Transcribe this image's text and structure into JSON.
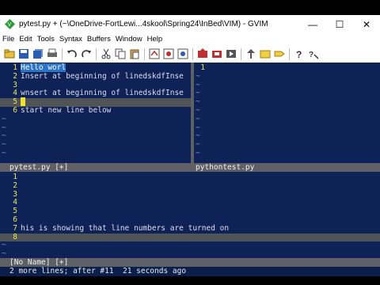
{
  "window": {
    "title": "pytest.py + (~\\OneDrive-FortLewi...4skool\\Spring24\\InBed\\VIM) - GVIM",
    "minimize": "—",
    "maximize": "☐",
    "close": "✕"
  },
  "menu": [
    "File",
    "Edit",
    "Tools",
    "Syntax",
    "Buffers",
    "Window",
    "Help"
  ],
  "top_left": {
    "lines": [
      {
        "n": "1",
        "text": "Hello worl"
      },
      {
        "n": "2",
        "text": "Insert at beginning of linedskdfInse"
      },
      {
        "n": "3",
        "text": ""
      },
      {
        "n": "4",
        "text": "wnsert at beginning of linedskdfInse"
      },
      {
        "n": "5",
        "text": ""
      },
      {
        "n": "6",
        "text": "start new line below"
      }
    ],
    "status": "pytest.py [+]"
  },
  "top_right": {
    "lines": [
      {
        "n": "1",
        "text": ""
      }
    ],
    "status": "pythontest.py"
  },
  "bottom": {
    "lines": [
      {
        "n": "1",
        "text": ""
      },
      {
        "n": "2",
        "text": ""
      },
      {
        "n": "3",
        "text": ""
      },
      {
        "n": "4",
        "text": ""
      },
      {
        "n": "5",
        "text": ""
      },
      {
        "n": "6",
        "text": ""
      },
      {
        "n": "7",
        "text": "his is showing that line numbers are turned on"
      },
      {
        "n": "8",
        "text": ""
      }
    ],
    "status": "[No Name] [+]"
  },
  "tilde": "~",
  "cmdline": "2 more lines; after #11  21 seconds ago",
  "colors": {
    "background": "#0f2258",
    "linenr": "#e6e65c",
    "statusline": "#5f6066"
  }
}
